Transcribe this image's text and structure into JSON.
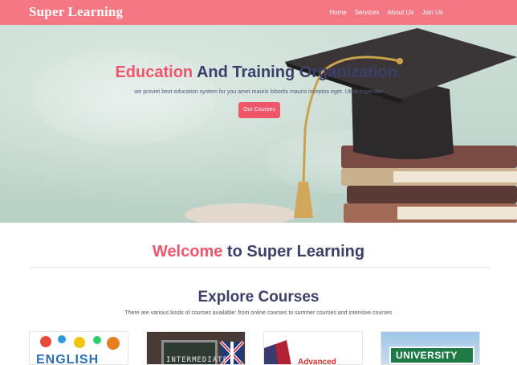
{
  "navbar": {
    "brand": "Super Learning",
    "links": [
      "Home",
      "Services",
      "About Us",
      "Join Us"
    ]
  },
  "hero": {
    "title_accent": "Education",
    "title_rest": " And Training Organization.",
    "subtitle": "we proviet best education system for you amet mauris lobortis mauris inceptos eget. Ulma imperdiet",
    "button_label": "Our Courses"
  },
  "welcome": {
    "accent": "Welcome",
    "rest": " to Super Learning"
  },
  "courses": {
    "title": "Explore Courses",
    "subtitle": "There are various kinds of courses available: from online courses to summer courses and intensive courses",
    "cards": [
      {
        "text": "ENGLISH"
      },
      {
        "text": "INTERMEDIATE"
      },
      {
        "text": "Advanced"
      },
      {
        "text": "UNIVERSITY"
      }
    ]
  },
  "colors": {
    "navbar": "#f57784",
    "accent": "#f0566a",
    "heading": "#3b3f6b"
  }
}
